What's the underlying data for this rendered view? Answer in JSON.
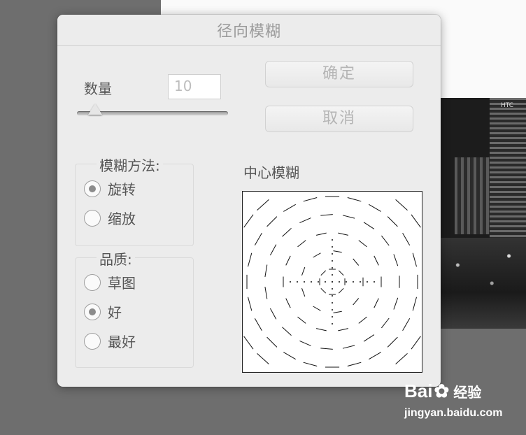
{
  "dialog": {
    "title": "径向模糊",
    "amount_label": "数量",
    "amount_value": "10",
    "amount_slider_fraction": 0.1,
    "ok_label": "确定",
    "cancel_label": "取消"
  },
  "method_group": {
    "legend": "模糊方法:",
    "options": [
      {
        "label": "旋转",
        "checked": true
      },
      {
        "label": "缩放",
        "checked": false
      }
    ]
  },
  "quality_group": {
    "legend": "品质:",
    "options": [
      {
        "label": "草图",
        "checked": false
      },
      {
        "label": "好",
        "checked": true
      },
      {
        "label": "最好",
        "checked": false
      }
    ]
  },
  "preview": {
    "label": "中心模糊"
  },
  "background": {
    "tower_sign": "HTC"
  },
  "watermark": {
    "logo_left": "Bai",
    "logo_right": "经验",
    "url": "jingyan.baidu.com"
  }
}
